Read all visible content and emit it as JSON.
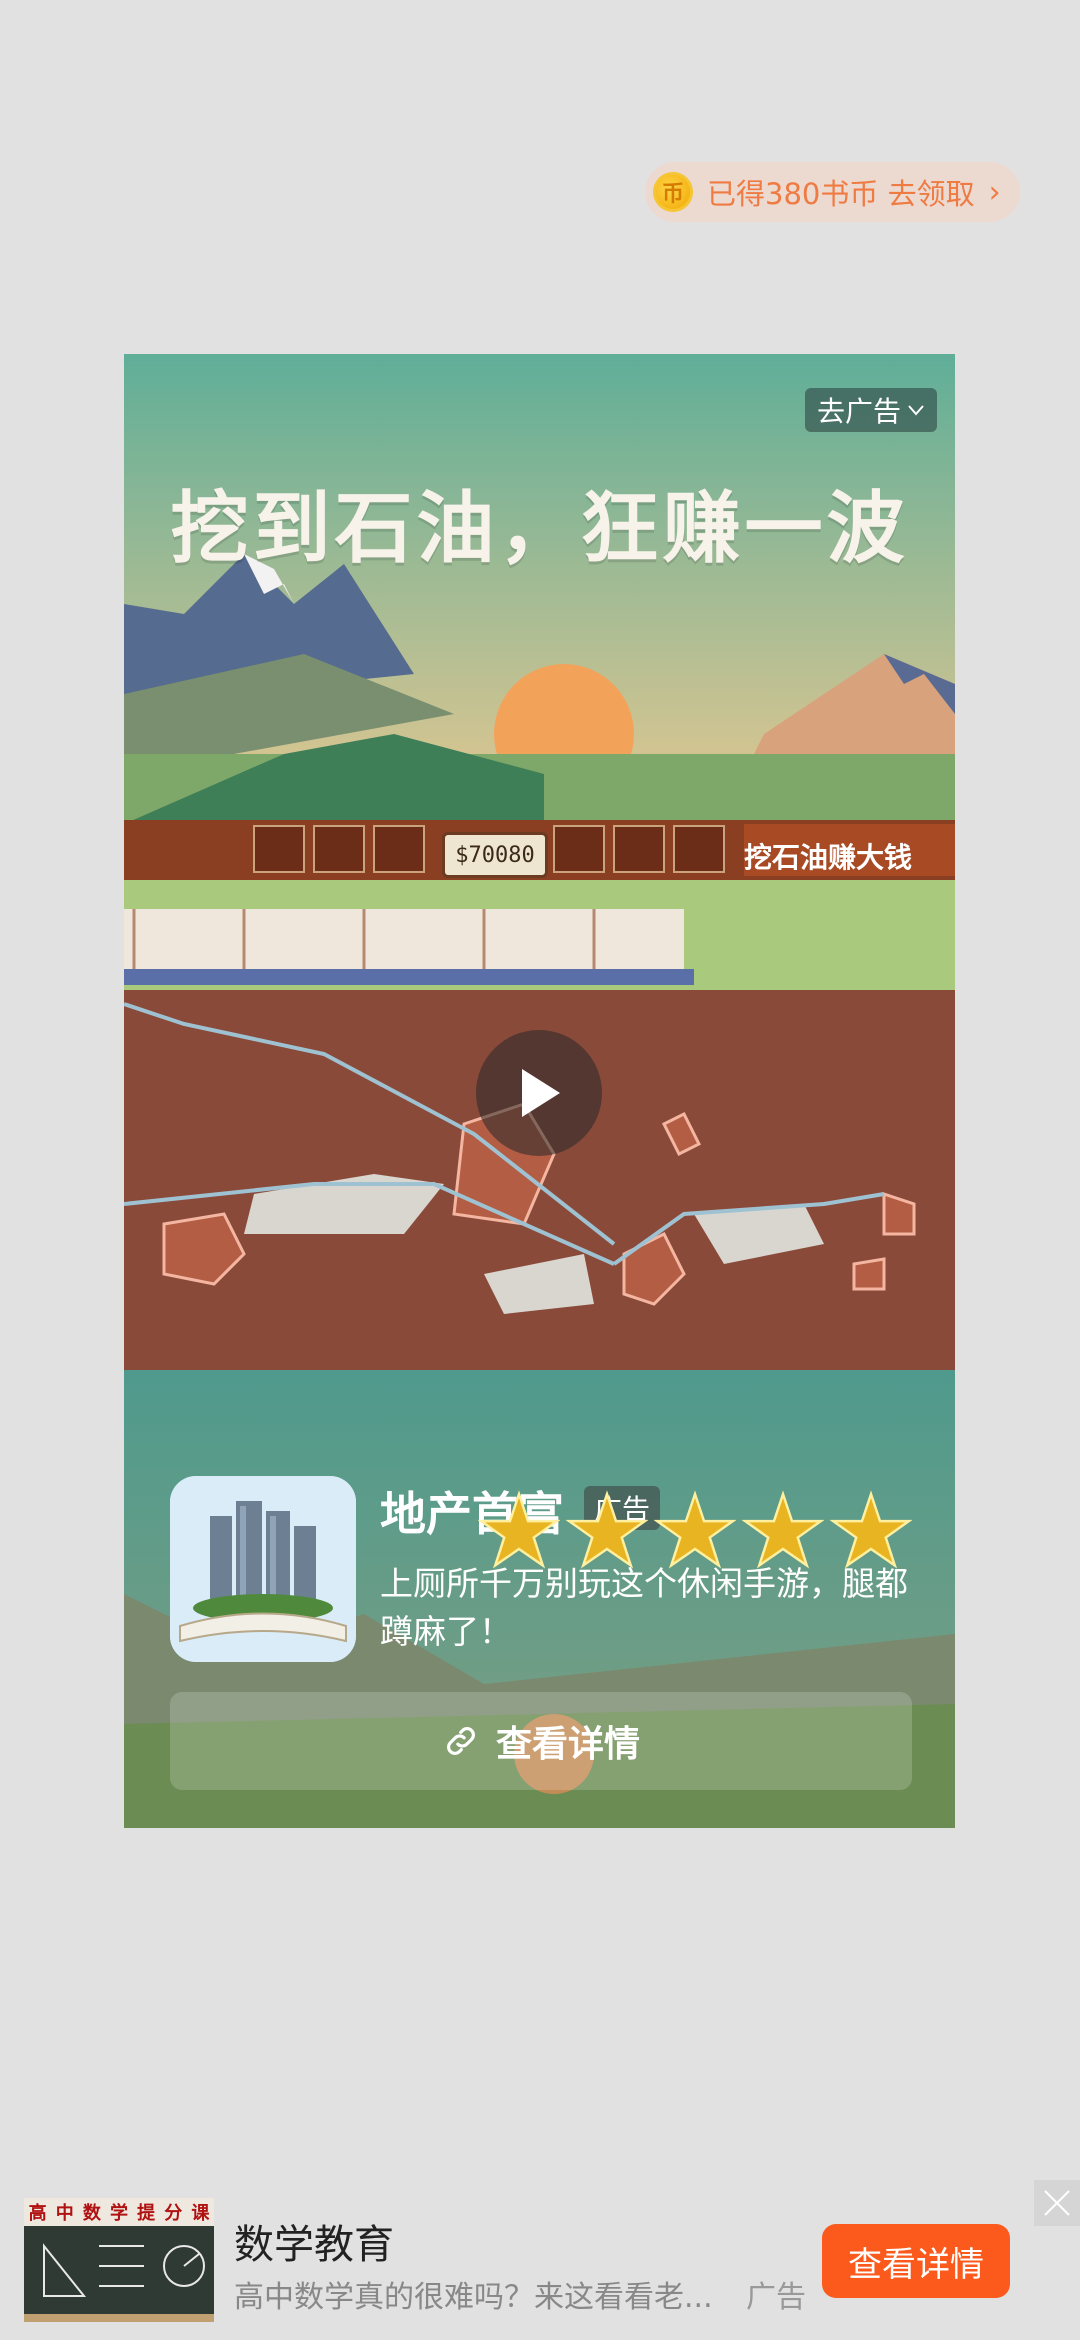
{
  "reward": {
    "coin_symbol": "币",
    "text": "已得380书币 去领取",
    "chevron": "›"
  },
  "ad": {
    "go_ad_label": "去广告",
    "banner_text": "挖到石油，狂赚一波",
    "hud_money": "$70080",
    "hud_label": "挖石油赚大钱",
    "app_name": "地产首富",
    "ad_tag": "广告",
    "rating": 5,
    "description": "上厕所千万别玩这个休闲手游，腿都蹲麻了！",
    "detail_label": "查看详情",
    "icons": {
      "link": "link-icon",
      "play": "play-icon",
      "chevron": "chevron-down-icon"
    }
  },
  "bottom_ad": {
    "thumb_header": [
      "高",
      "中",
      "数",
      "学",
      "提",
      "分",
      "课"
    ],
    "title": "数学教育",
    "description": "高中数学真的很难吗？来这看看老...",
    "ad_tag": "广告",
    "cta": "查看详情"
  }
}
